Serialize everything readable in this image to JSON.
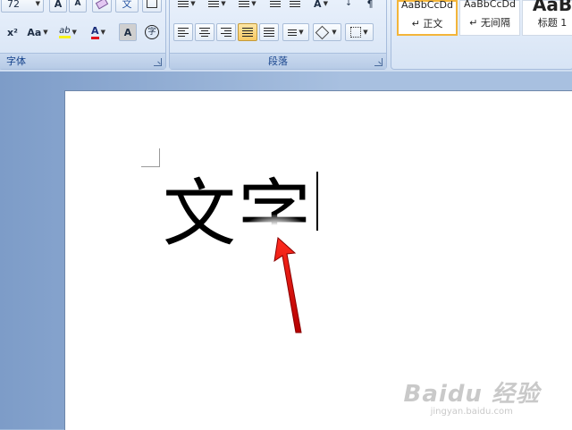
{
  "ribbon": {
    "font_group": {
      "label": "字体",
      "font_size": "72",
      "grow_font": "A",
      "shrink_font": "A",
      "superscript": "x²",
      "change_case": "Aa",
      "highlight": "ab",
      "font_color": "A",
      "char_shading": "A",
      "enclose_char": "字",
      "top_partial": "文"
    },
    "paragraph_group": {
      "label": "段落"
    },
    "styles": [
      {
        "sample": "AaBbCcDd",
        "name": "↵ 正文",
        "selected": true
      },
      {
        "sample": "AaBbCcDd",
        "name": "↵ 无间隔",
        "selected": false
      },
      {
        "sample": "AaB",
        "name": "标题 1",
        "selected": false
      }
    ]
  },
  "document": {
    "text": "文字"
  },
  "watermark": {
    "main": "Baidu 经验",
    "sub": "jingyan.baidu.com"
  }
}
